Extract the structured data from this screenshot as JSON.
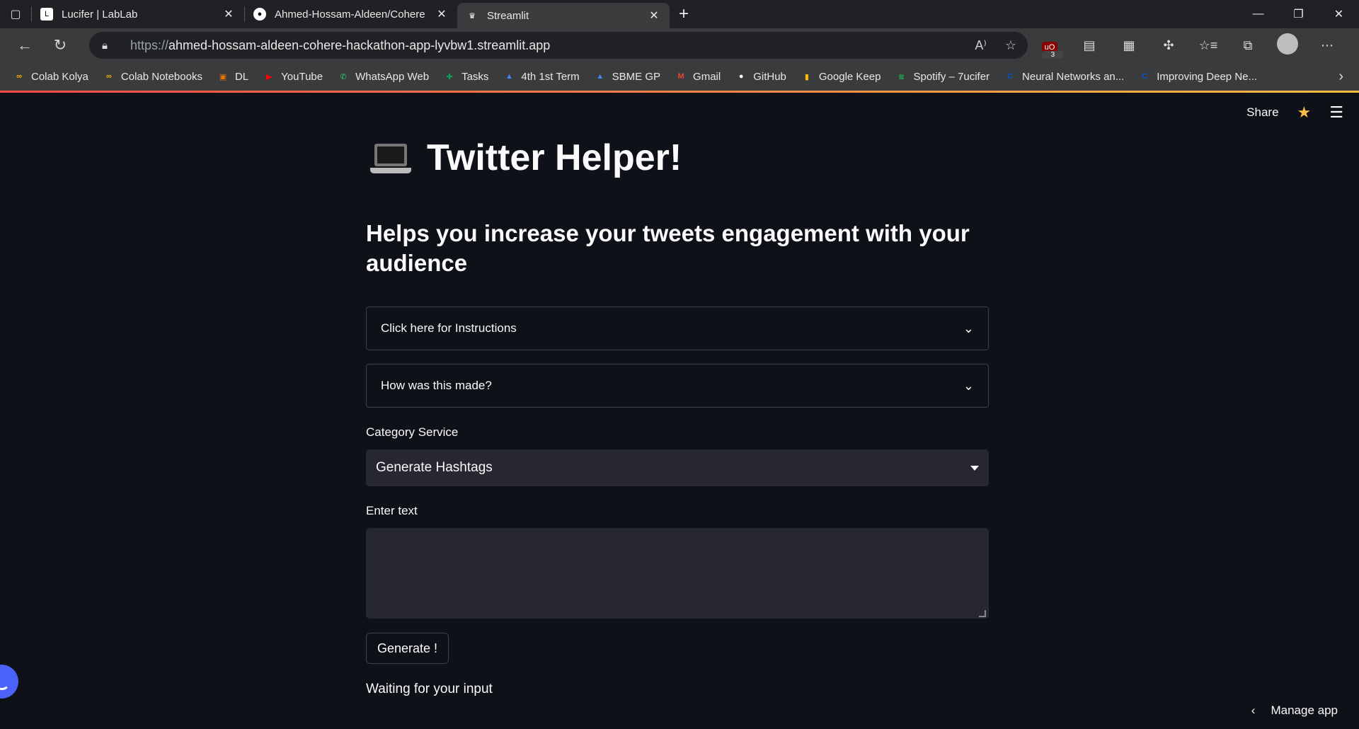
{
  "browser": {
    "tabs": [
      {
        "title": "Lucifer | LabLab",
        "icon": "lablab-icon",
        "active": false
      },
      {
        "title": "Ahmed-Hossam-Aldeen/Cohere",
        "icon": "github-icon",
        "active": false
      },
      {
        "title": "Streamlit",
        "icon": "streamlit-icon",
        "active": true
      }
    ],
    "url_protocol": "https://",
    "url_host": "ahmed-hossam-aldeen-cohere-hackathon-app-lyvbw1.streamlit.app",
    "ublock_badge": "3",
    "bookmarks": [
      {
        "label": "Colab Kolya",
        "icon": "colab-icon",
        "color": "#f9ab00"
      },
      {
        "label": "Colab Notebooks",
        "icon": "colab-icon",
        "color": "#f9ab00"
      },
      {
        "label": "DL",
        "icon": "folder-user-icon",
        "color": "#e8710a"
      },
      {
        "label": "YouTube",
        "icon": "youtube-icon",
        "color": "#ff0000"
      },
      {
        "label": "WhatsApp Web",
        "icon": "whatsapp-icon",
        "color": "#25d366"
      },
      {
        "label": "Tasks",
        "icon": "tasks-icon",
        "color": "#0f9d58"
      },
      {
        "label": "4th 1st Term",
        "icon": "google-drive-icon",
        "color": "#4285f4"
      },
      {
        "label": "SBME GP",
        "icon": "google-drive-icon",
        "color": "#4285f4"
      },
      {
        "label": "Gmail",
        "icon": "gmail-icon",
        "color": "#ea4335"
      },
      {
        "label": "GitHub",
        "icon": "github-icon",
        "color": "#ffffff"
      },
      {
        "label": "Google Keep",
        "icon": "google-keep-icon",
        "color": "#fbbc04"
      },
      {
        "label": "Spotify – 7ucifer",
        "icon": "spotify-icon",
        "color": "#1db954"
      },
      {
        "label": "Neural Networks an...",
        "icon": "coursera-icon",
        "color": "#0056d2"
      },
      {
        "label": "Improving Deep Ne...",
        "icon": "coursera-icon",
        "color": "#0056d2"
      }
    ]
  },
  "app": {
    "header": {
      "share_label": "Share"
    },
    "title": "Twitter Helper!",
    "subtitle": "Helps you increase your tweets engagement with your audience",
    "expanders": [
      {
        "label": "Click here for Instructions"
      },
      {
        "label": "How was this made?"
      }
    ],
    "category": {
      "label": "Category Service",
      "selected": "Generate Hashtags"
    },
    "text_input": {
      "label": "Enter text",
      "value": ""
    },
    "generate_button": "Generate !",
    "status": "Waiting for your input",
    "manage_app": "Manage app"
  },
  "colors": {
    "accent_start": "#ff4b4b",
    "accent_end": "#ffbd45",
    "background": "#0e1117",
    "input_bg": "#262730"
  }
}
